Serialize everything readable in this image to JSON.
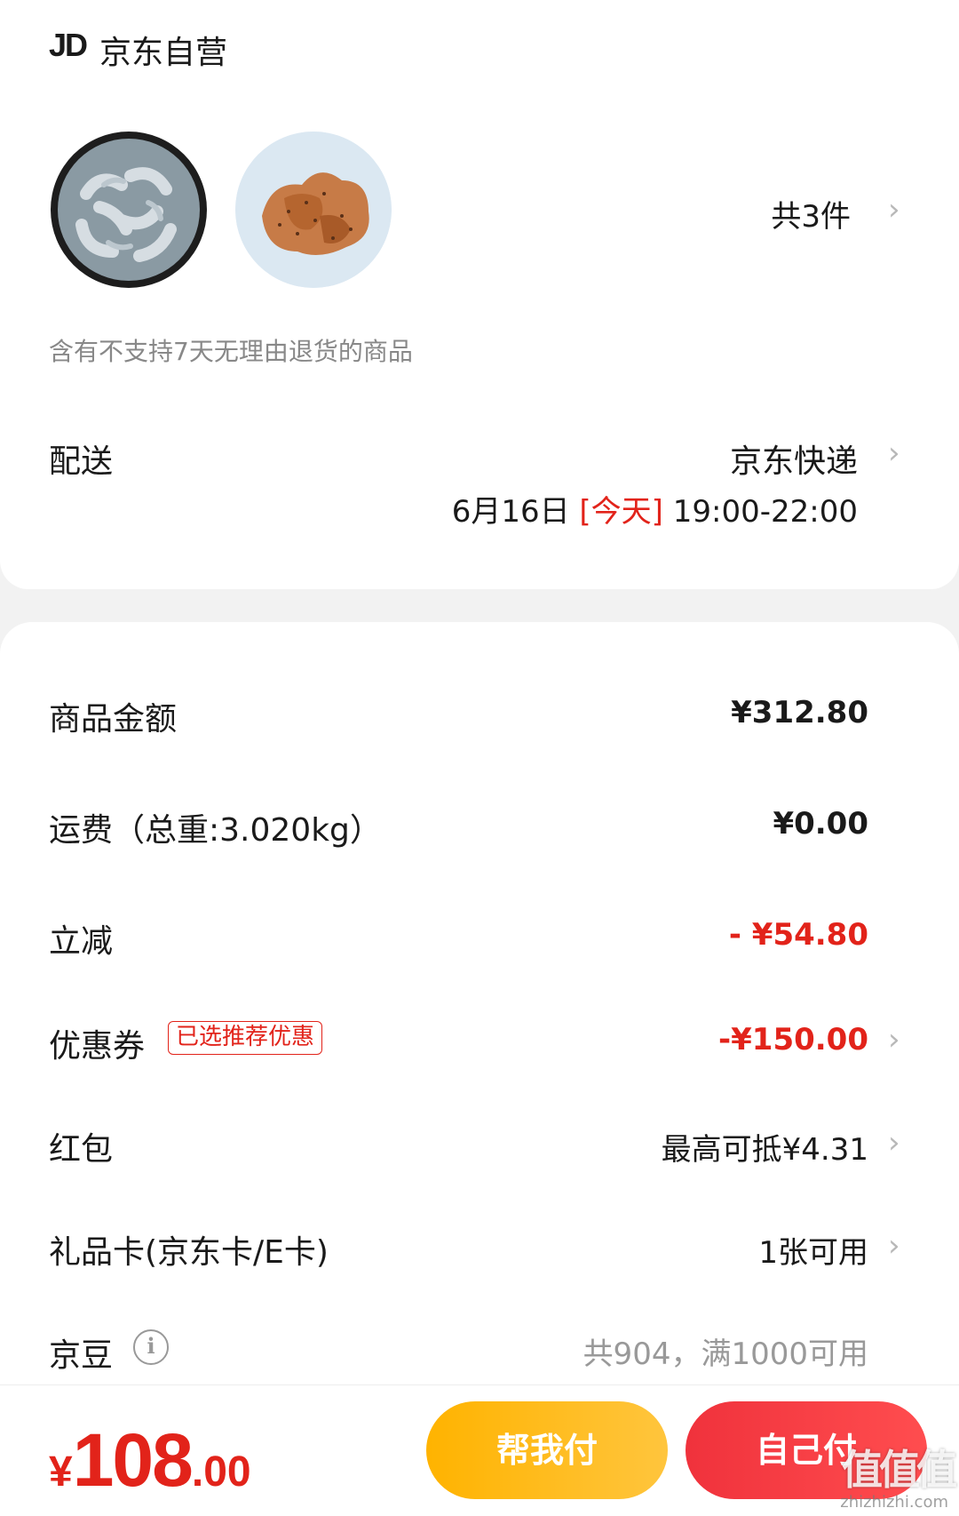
{
  "store": {
    "logo": "JD",
    "name": "京东自营"
  },
  "items": {
    "count_label": "共3件",
    "products": [
      {
        "icon": "shrimp-product-image"
      },
      {
        "icon": "chicken-cutlet-product-image"
      }
    ]
  },
  "notice": "含有不支持7天无理由退货的商品",
  "shipping": {
    "label": "配送",
    "method": "京东快递",
    "date": "6月16日",
    "today": "[今天]",
    "time_range": "19:00-22:00"
  },
  "summary": {
    "goods_label": "商品金额",
    "goods_value": "¥312.80",
    "freight_label": "运费（总重:3.020kg）",
    "freight_value": "¥0.00",
    "discount_label": "立减",
    "discount_value": "- ¥54.80",
    "coupon_label": "优惠券",
    "coupon_tag": "已选推荐优惠",
    "coupon_value": "-¥150.00",
    "redpacket_label": "红包",
    "redpacket_value": "最高可抵¥4.31",
    "giftcard_label": "礼品卡(京东卡/E卡)",
    "giftcard_value": "1张可用",
    "jingdou_label": "京豆",
    "jingdou_value": "共904，满1000可用"
  },
  "footer": {
    "total_symbol": "¥",
    "total_integer": "108",
    "total_decimal": ".00",
    "help_pay_label": "帮我付",
    "self_pay_label": "自己付"
  },
  "watermark": {
    "text": "值值值",
    "url": "zhizhizhi.com"
  },
  "colors": {
    "accent_red": "#e2231a",
    "help_button": "#ffb300",
    "self_button": "#f0323c"
  }
}
